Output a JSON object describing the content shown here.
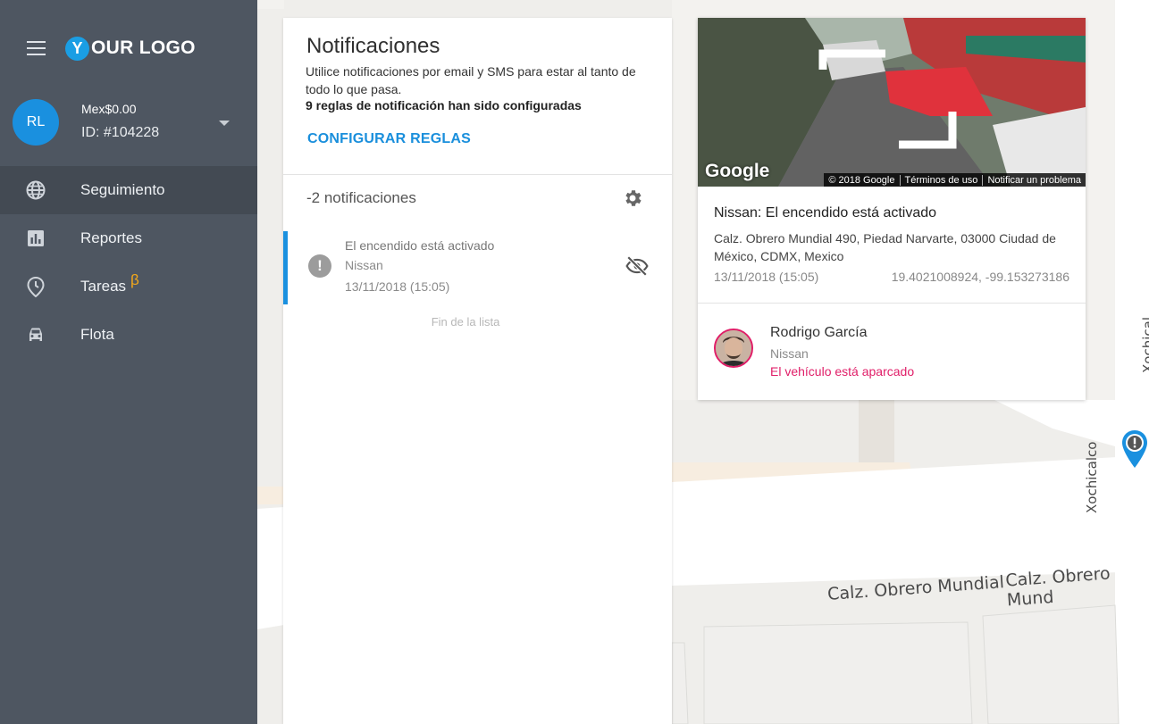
{
  "sidebar": {
    "logo_mark": "Y",
    "logo_text": "OUR LOGO",
    "account": {
      "initials": "RL",
      "balance": "Mex$0.00",
      "id": "ID: #104228"
    },
    "nav": [
      {
        "label": "Seguimiento",
        "icon": "globe-icon",
        "active": true
      },
      {
        "label": "Reportes",
        "icon": "bar-chart-icon"
      },
      {
        "label": "Tareas",
        "icon": "clock-pin-icon",
        "badge": "β"
      },
      {
        "label": "Flota",
        "icon": "car-icon"
      }
    ]
  },
  "notifications": {
    "title": "Notificaciones",
    "description": "Utilice notificaciones por email y SMS para estar al tanto de todo lo que pasa.",
    "rules_summary": "9 reglas de notificación han sido configuradas",
    "config_link": "CONFIGURAR REGLAS",
    "count_label": "-2 notificaciones",
    "items": [
      {
        "title": "El encendido está activado",
        "vehicle": "Nissan",
        "date": "13/11/2018 (15:05)"
      }
    ],
    "end_label": "Fin de la lista"
  },
  "detail": {
    "street_view": {
      "brand": "Google",
      "attribution": [
        "© 2018 Google",
        "Términos de uso",
        "Notificar un problema"
      ]
    },
    "title": "Nissan: El encendido está activado",
    "address": "Calz. Obrero Mundial 490, Piedad Narvarte, 03000 Ciudad de México, CDMX, Mexico",
    "date": "13/11/2018 (15:05)",
    "coords": "19.4021008924, -99.153273186",
    "driver": {
      "name": "Rodrigo García",
      "vehicle": "Nissan",
      "status": "El vehículo está aparcado",
      "status_color": "#e01e68"
    }
  },
  "map": {
    "streets": [
      "Calz. Obrero Mundial",
      "Calz. Obrero Mund",
      "Xochicalco",
      "Xochical"
    ]
  },
  "colors": {
    "sidebar_bg": "#4e5661",
    "accent": "#1a90df",
    "beta": "#f3a81b"
  }
}
